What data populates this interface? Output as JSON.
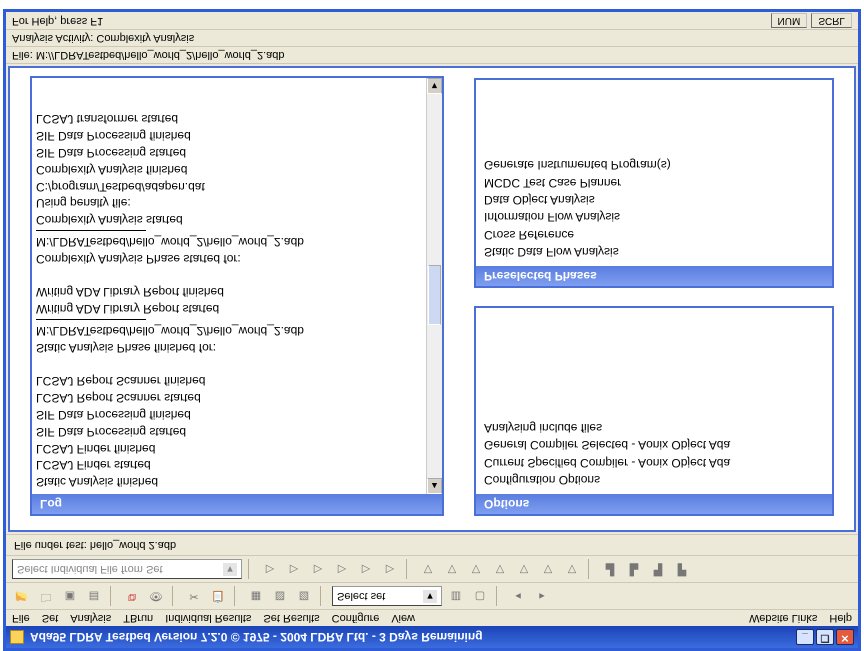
{
  "window": {
    "title": "Ada95 LDRA Testbed Version 7.2.0 © 1975 - 2004 LDRA Ltd. - 3 Days Remaining"
  },
  "menu": {
    "items": [
      "File",
      "Set",
      "Analysis",
      "TBrun",
      "Individual Results",
      "Set Results",
      "Configure",
      "View"
    ],
    "right": [
      "Website Links",
      "Help"
    ]
  },
  "toolbar1": {
    "combo": "Select set"
  },
  "toolbar2": {
    "combo_placeholder": "Select Individual File from Set"
  },
  "file_under_test": {
    "label": "File under test:",
    "value": "hello_world 2.adb"
  },
  "panels": {
    "log_title": "Log",
    "options_title": "Options",
    "phases_title": "Preselected Phases"
  },
  "options": {
    "items": [
      "Configuration Options",
      "Current Specified Compiler - Aonix Object Ada",
      "General Compiler Selected - Aonix Object Ada",
      "Analysing include files"
    ]
  },
  "phases": {
    "items": [
      "Static Data Flow Analysis",
      "Cross Reference",
      "Information Flow Analysis",
      "Data Object Analysis",
      "MCDC Test Case Planner",
      "Generate Instrumented Program(s)"
    ]
  },
  "log": {
    "lines": [
      "Static Analysis finished",
      "LCSAJ Finder started",
      "LCSAJ Finder finished",
      "SIF Data Processing started",
      "SIF Data Processing finished",
      "LCSAJ Report Scanner started",
      "LCSAJ Report Scanner finished",
      "",
      "Static Analysis Phase finished for:",
      "M:/LDRATestbed/hello_world_2/hello_world_2.adb",
      "RULE",
      "Writing ADA Library Report started",
      "Writing ADA Library Report finished",
      "",
      "Complexity Analysis Phase started for:",
      "M:/LDRATestbed/hello_world_2/hello_world_2.adb",
      "RULE",
      "Complexity Analysis started",
      "Using penalty file:",
      "C:/program/Testbed/adapen.dat",
      "Complexity Analysis finished",
      "SIF Data Processing started",
      "SIF Data Processing finished",
      "LCSAJ transformer started"
    ]
  },
  "bottom": {
    "file_label": "File:",
    "file_path": "M://LDRATestbed/hello_world_2/hello_world_2.adb",
    "activity_label": "Analysis Activity:",
    "activity": "Complexity Analysis"
  },
  "status": {
    "help": "For Help, press F1",
    "seg1": "NUM",
    "seg2": "SCRL"
  }
}
